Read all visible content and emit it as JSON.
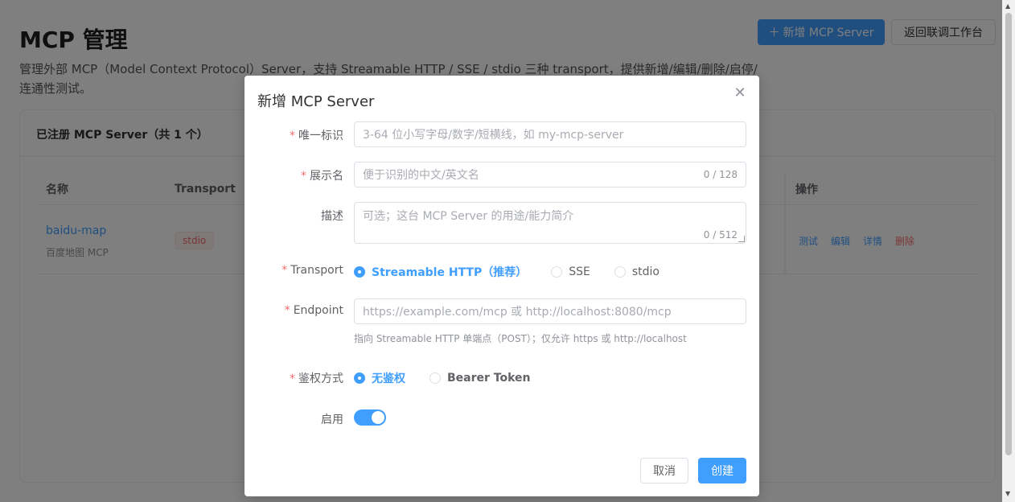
{
  "page": {
    "title": "MCP 管理",
    "description": "管理外部 MCP（Model Context Protocol）Server，支持 Streamable HTTP / SSE / stdio 三种 transport，提供新增/编辑/删除/启停/连通性测试。",
    "add_button": "新增 MCP Server",
    "back_button": "返回联调工作台"
  },
  "card": {
    "header": "已注册 MCP Server（共 1 个）",
    "columns": {
      "name": "名称",
      "transport": "Transport",
      "ops": "操作"
    },
    "rows": [
      {
        "name": "baidu-map",
        "subtitle": "百度地图 MCP",
        "transport": "stdio",
        "ops": [
          "测试",
          "编辑",
          "详情",
          "删除"
        ]
      }
    ]
  },
  "dialog": {
    "title": "新增 MCP Server",
    "fields": {
      "id": {
        "label": "唯一标识",
        "placeholder": "3-64 位小写字母/数字/短横线，如 my-mcp-server"
      },
      "display_name": {
        "label": "展示名",
        "placeholder": "便于识别的中文/英文名",
        "counter": "0 / 128"
      },
      "description": {
        "label": "描述",
        "placeholder": "可选；这台 MCP Server 的用途/能力简介",
        "counter": "0 / 512"
      },
      "transport": {
        "label": "Transport",
        "options": [
          "Streamable HTTP（推荐）",
          "SSE",
          "stdio"
        ],
        "selected": "Streamable HTTP（推荐）"
      },
      "endpoint": {
        "label": "Endpoint",
        "placeholder": "https://example.com/mcp 或 http://localhost:8080/mcp",
        "hint": "指向 Streamable HTTP 单端点（POST）；仅允许 https 或 http://localhost"
      },
      "auth": {
        "label": "鉴权方式",
        "options": [
          "无鉴权",
          "Bearer Token"
        ],
        "selected": "无鉴权"
      },
      "enabled": {
        "label": "启用",
        "value": true
      }
    },
    "cancel": "取消",
    "create": "创建"
  },
  "colors": {
    "primary": "#409eff",
    "danger": "#f56c6c",
    "required": "#f56c6c"
  }
}
